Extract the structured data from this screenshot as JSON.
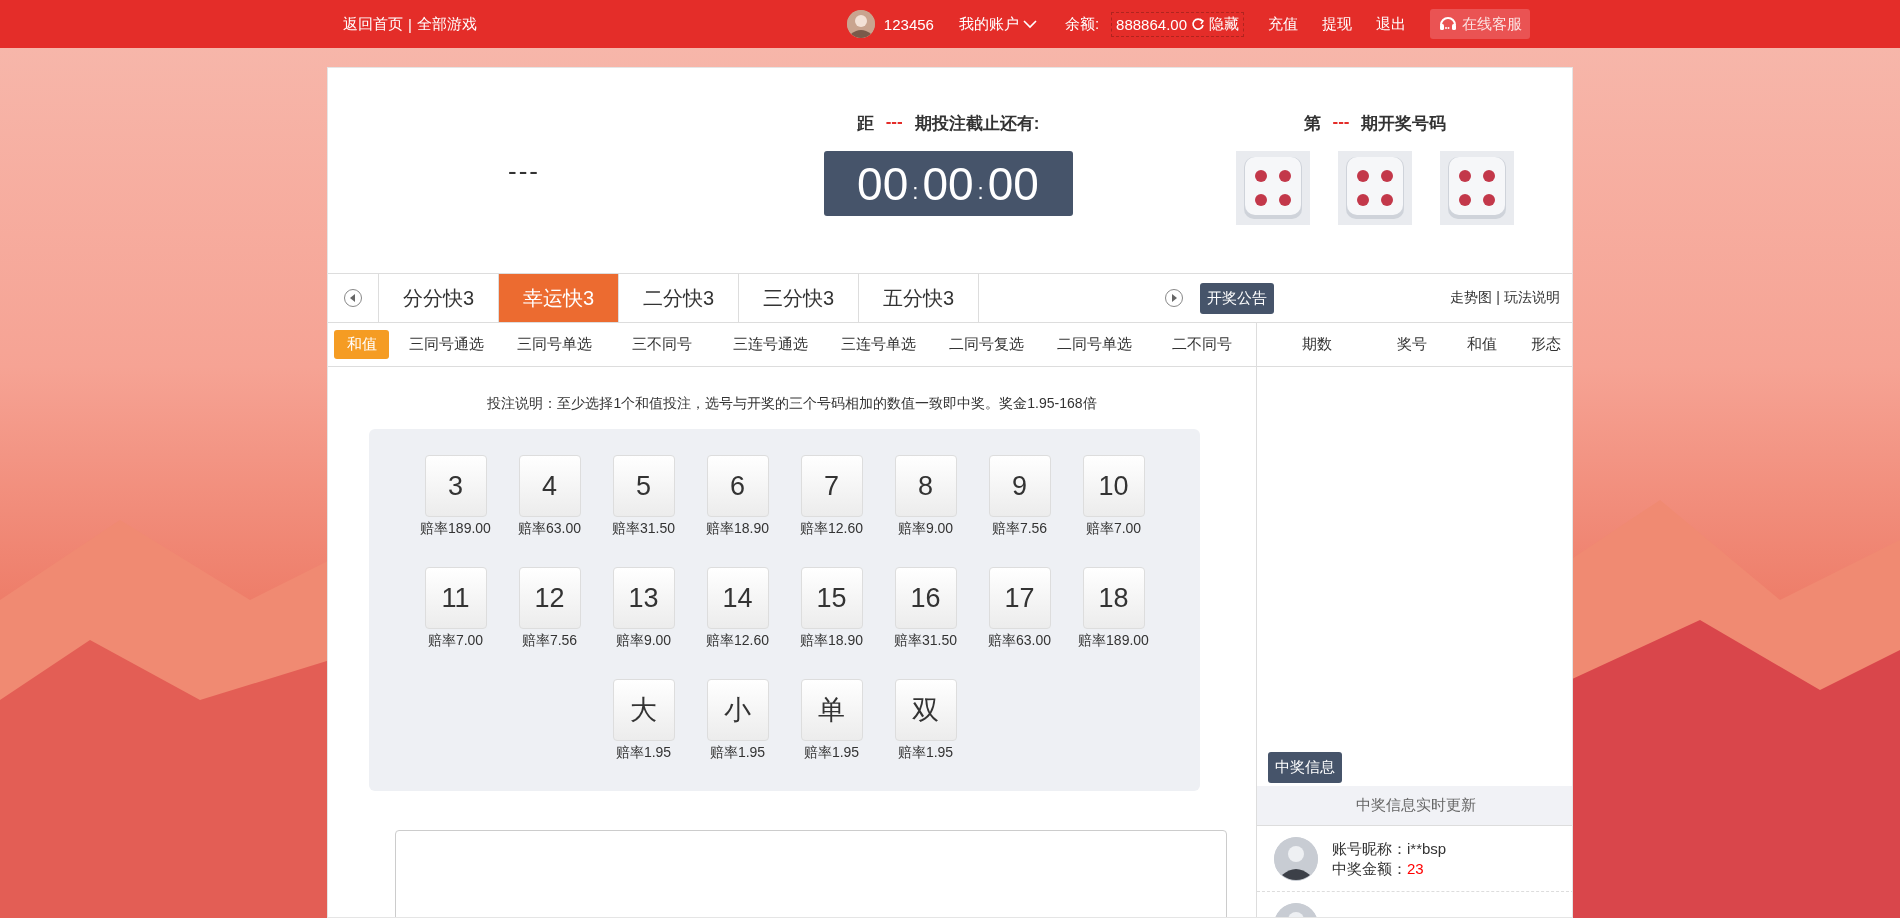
{
  "top_bar": {
    "nav_links": [
      "返回首页",
      "全部游戏"
    ],
    "nav_separator": "|",
    "user_name": "123456",
    "account_menu": "我的账户",
    "balance_label": "余额:",
    "balance": "888864.00",
    "hide_label": "隐藏",
    "links": [
      "充值",
      "提现",
      "退出"
    ],
    "support": "在线客服"
  },
  "header": {
    "current_issue": "---",
    "countdown": {
      "prefix": "距",
      "issue": "---",
      "suffix": "期投注截止还有:",
      "parts": [
        "00",
        "00",
        "00"
      ],
      "separator": ":"
    },
    "draw": {
      "prefix": "第",
      "issue": "---",
      "suffix": "期开奖号码",
      "dice": [
        {
          "kind": "four"
        },
        {
          "kind": "four"
        },
        {
          "kind": "four"
        }
      ]
    }
  },
  "game_tabs": [
    {
      "label": "分分快3",
      "selected": false
    },
    {
      "label": "幸运快3",
      "selected": true
    },
    {
      "label": "二分快3",
      "selected": false
    },
    {
      "label": "三分快3",
      "selected": false
    },
    {
      "label": "五分快3",
      "selected": false
    }
  ],
  "announcement_button": "开奖公告",
  "help_links": [
    "走势图",
    "玩法说明"
  ],
  "help_separator": "|",
  "play_tabs": [
    {
      "label": "和值",
      "selected": true
    },
    {
      "label": "三同号通选",
      "selected": false
    },
    {
      "label": "三同号单选",
      "selected": false
    },
    {
      "label": "三不同号",
      "selected": false
    },
    {
      "label": "三连号通选",
      "selected": false
    },
    {
      "label": "三连号单选",
      "selected": false
    },
    {
      "label": "二同号复选",
      "selected": false
    },
    {
      "label": "二同号单选",
      "selected": false
    },
    {
      "label": "二不同号",
      "selected": false
    }
  ],
  "instruction": "投注说明：至少选择1个和值投注，选号与开奖的三个号码相加的数值一致即中奖。奖金1.95-168倍",
  "bet_rows": [
    [
      {
        "label": "3",
        "odds": "赔率189.00"
      },
      {
        "label": "4",
        "odds": "赔率63.00"
      },
      {
        "label": "5",
        "odds": "赔率31.50"
      },
      {
        "label": "6",
        "odds": "赔率18.90"
      },
      {
        "label": "7",
        "odds": "赔率12.60"
      },
      {
        "label": "8",
        "odds": "赔率9.00"
      },
      {
        "label": "9",
        "odds": "赔率7.56"
      },
      {
        "label": "10",
        "odds": "赔率7.00"
      }
    ],
    [
      {
        "label": "11",
        "odds": "赔率7.00"
      },
      {
        "label": "12",
        "odds": "赔率7.56"
      },
      {
        "label": "13",
        "odds": "赔率9.00"
      },
      {
        "label": "14",
        "odds": "赔率12.60"
      },
      {
        "label": "15",
        "odds": "赔率18.90"
      },
      {
        "label": "16",
        "odds": "赔率31.50"
      },
      {
        "label": "17",
        "odds": "赔率63.00"
      },
      {
        "label": "18",
        "odds": "赔率189.00"
      }
    ],
    [
      {
        "label": "大",
        "odds": "赔率1.95"
      },
      {
        "label": "小",
        "odds": "赔率1.95"
      },
      {
        "label": "单",
        "odds": "赔率1.95"
      },
      {
        "label": "双",
        "odds": "赔率1.95"
      }
    ]
  ],
  "history": {
    "columns": [
      "期数",
      "奖号",
      "和值",
      "形态"
    ]
  },
  "winners": {
    "title": "中奖信息",
    "banner": "中奖信息实时更新",
    "entries": [
      {
        "kind": "full",
        "name_label": "账号昵称：",
        "name": "i**bsp",
        "amount_label": "中奖金额：",
        "amount": "23"
      },
      {
        "kind": "cut"
      }
    ]
  }
}
